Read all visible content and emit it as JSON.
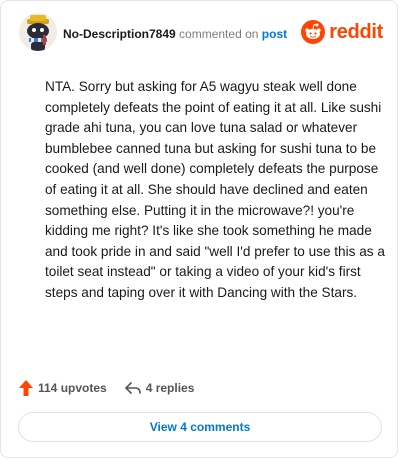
{
  "comment": {
    "username": "No-Description7849",
    "commented_text": "commented on",
    "post_link": "post",
    "body": "NTA. Sorry but asking for A5 wagyu steak well done completely defeats the point of eating it at all. Like sushi grade ahi tuna, you can love tuna salad or whatever bumblebee canned tuna but asking for sushi tuna to be cooked (and well done) completely defeats the purpose of eating it at all. She should have declined and eaten something else. Putting it in the microwave?! you're kidding me right? It's like she took something he made and took pride in and said \"well I'd prefer to use this as a toilet seat instead\" or taking a video of your kid's first steps and taping over it with Dancing with the Stars."
  },
  "brand": {
    "wordmark": "reddit",
    "icon": "reddit-logo-icon",
    "color": "#ff4500"
  },
  "actions": {
    "upvotes_label": "114 upvotes",
    "upvote_icon": "upvote-arrow-icon",
    "upvote_color": "#ff4500",
    "replies_label": "4 replies",
    "reply_icon": "reply-arrow-icon"
  },
  "footer": {
    "view_comments_label": "View 4 comments",
    "link_color": "#0079d3"
  }
}
